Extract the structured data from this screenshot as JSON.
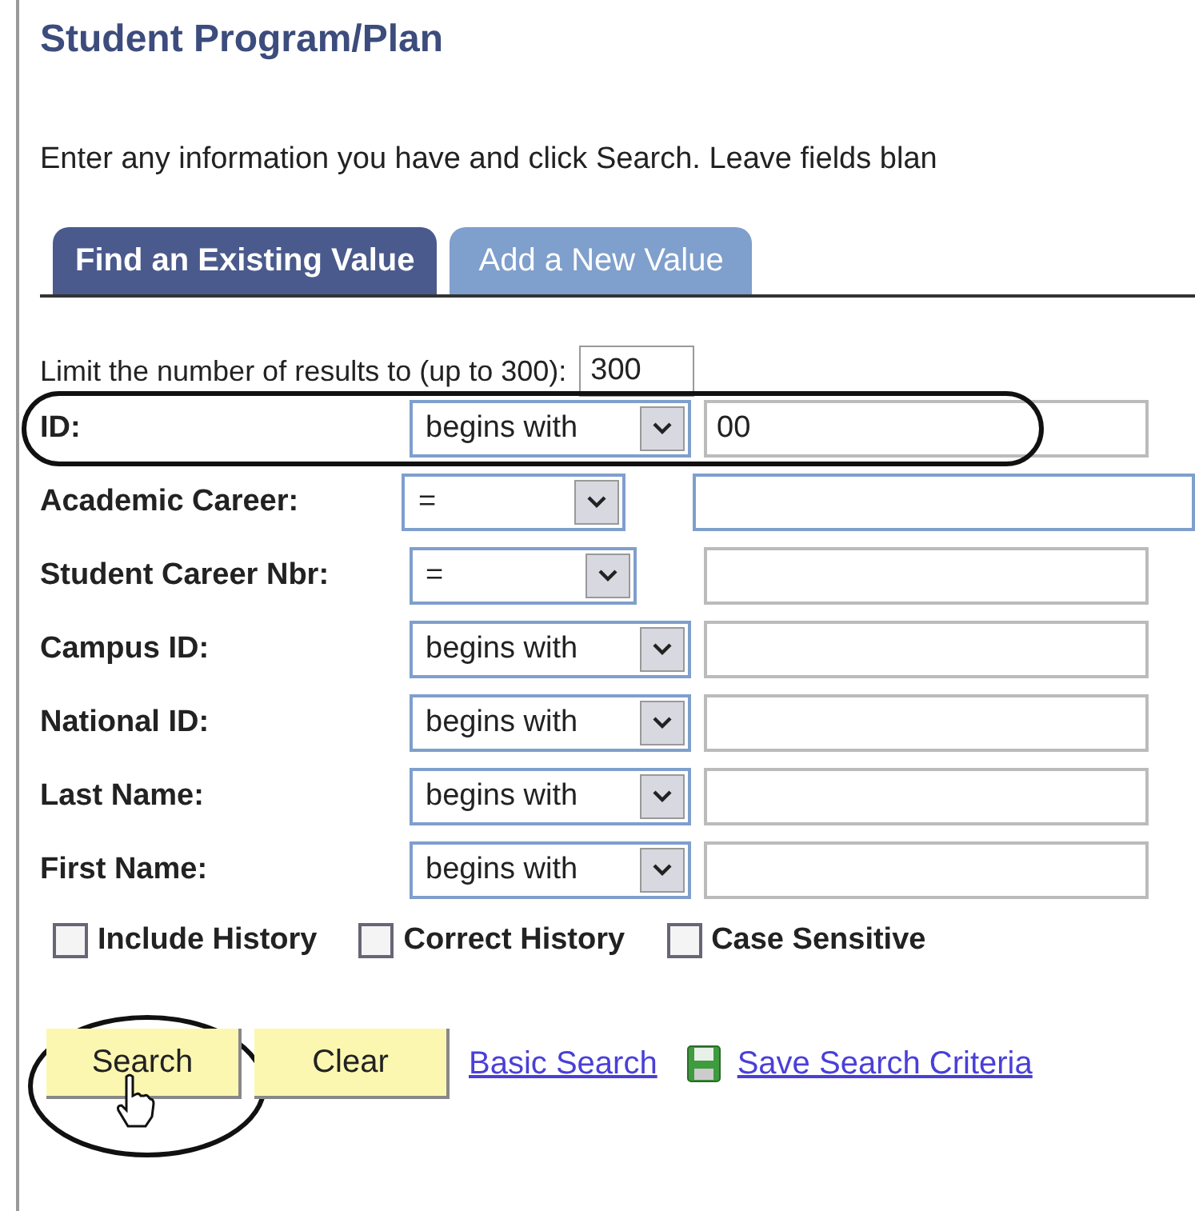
{
  "title": "Student Program/Plan",
  "instructions": "Enter any information you have and click Search. Leave fields blan",
  "tabs": [
    {
      "label": "Find an Existing Value",
      "selected": true
    },
    {
      "label": "Add a New Value",
      "selected": false
    }
  ],
  "limit": {
    "label": "Limit the number of results to (up to 300):",
    "value": "300"
  },
  "fields": [
    {
      "label": "ID:",
      "operator": "begins with",
      "kind": "text",
      "value": "00",
      "wide": false,
      "circled": true
    },
    {
      "label": "Academic Career:",
      "operator": "=",
      "kind": "list",
      "wide": true,
      "circled": false
    },
    {
      "label": "Student Career Nbr:",
      "operator": "=",
      "kind": "list",
      "wide": false,
      "circled": false
    },
    {
      "label": "Campus ID:",
      "operator": "begins with",
      "kind": "text",
      "wide": false,
      "circled": false
    },
    {
      "label": "National ID:",
      "operator": "begins with",
      "kind": "text",
      "wide": false,
      "circled": false
    },
    {
      "label": "Last Name:",
      "operator": "begins with",
      "kind": "text",
      "wide": false,
      "circled": false
    },
    {
      "label": "First Name:",
      "operator": "begins with",
      "kind": "text",
      "wide": false,
      "circled": false
    }
  ],
  "options": [
    {
      "label": "Include History",
      "checked": false
    },
    {
      "label": "Correct History",
      "checked": false
    },
    {
      "label": "Case Sensitive",
      "checked": false
    }
  ],
  "buttons": [
    {
      "label": "Search",
      "circled": true
    },
    {
      "label": "Clear",
      "circled": false
    }
  ],
  "links": [
    {
      "label": "Basic Search",
      "kind": "plain"
    },
    {
      "label": "Save Search Criteria",
      "kind": "save"
    }
  ]
}
